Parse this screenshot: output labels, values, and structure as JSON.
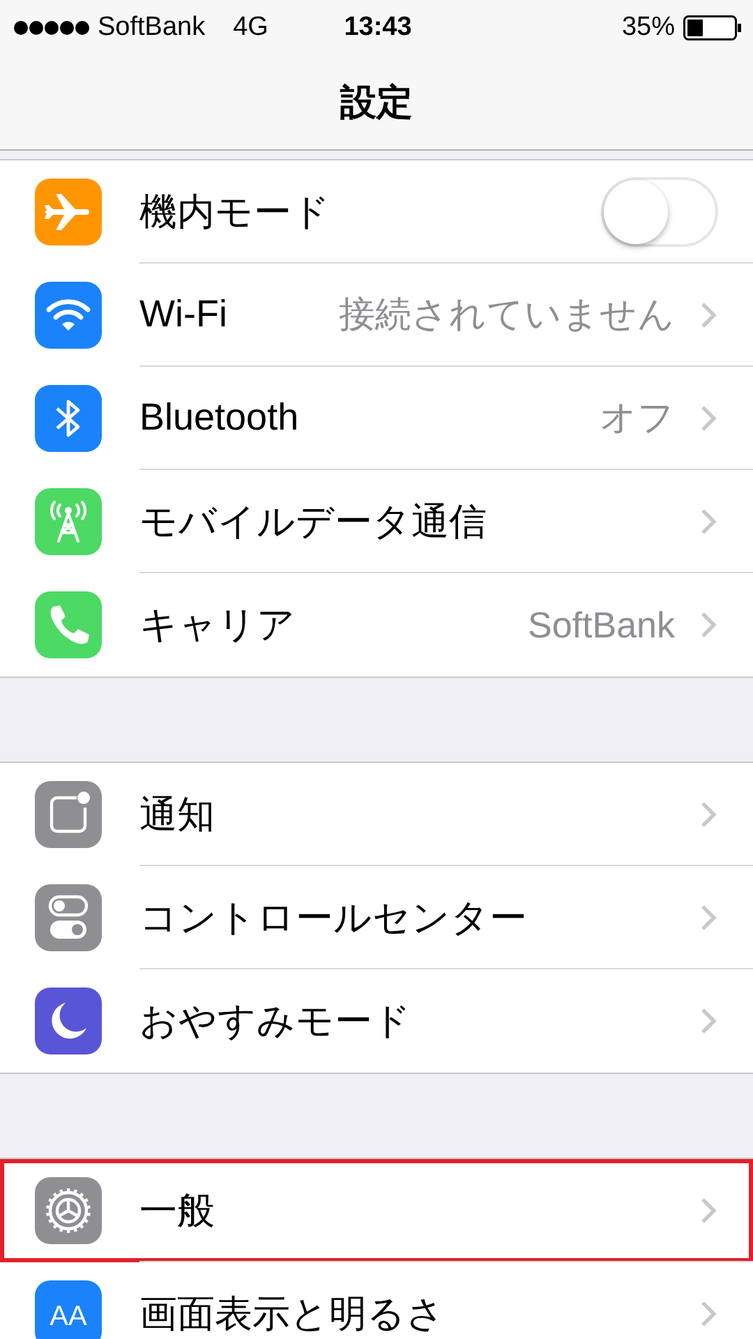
{
  "status_bar": {
    "carrier": "SoftBank",
    "network": "4G",
    "time": "13:43",
    "battery": "35%"
  },
  "nav_bar": {
    "title": "設定"
  },
  "groups": [
    {
      "rows": [
        {
          "label": "機内モード",
          "color": "#ff9500",
          "kind": "toggle",
          "on": false
        },
        {
          "label": "Wi-Fi",
          "color": "#1a82fb",
          "kind": "link",
          "value": "接続されていません"
        },
        {
          "label": "Bluetooth",
          "color": "#1a82fb",
          "kind": "link",
          "value": "オフ"
        },
        {
          "label": "モバイルデータ通信",
          "color": "#4cd964",
          "kind": "link"
        },
        {
          "label": "キャリア",
          "color": "#4cd964",
          "kind": "link",
          "value": "SoftBank"
        }
      ]
    },
    {
      "rows": [
        {
          "label": "通知",
          "color": "#8e8e93",
          "kind": "link"
        },
        {
          "label": "コントロールセンター",
          "color": "#8e8e93",
          "kind": "link"
        },
        {
          "label": "おやすみモード",
          "color": "#5856d6",
          "kind": "link"
        }
      ]
    },
    {
      "rows": [
        {
          "label": "一般",
          "color": "#8e8e93",
          "kind": "link",
          "highlighted": true
        },
        {
          "label": "画面表示と明るさ",
          "color": "#1a82fb",
          "kind": "link",
          "icon_text": "AA"
        }
      ]
    }
  ]
}
